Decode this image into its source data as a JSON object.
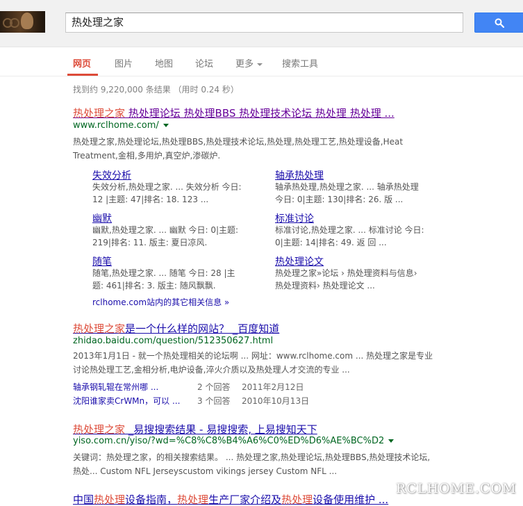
{
  "search": {
    "query": "热处理之家"
  },
  "tabs": [
    "网页",
    "图片",
    "地图",
    "论坛",
    "更多",
    "搜索工具"
  ],
  "stats": "找到约 9,220,000 条结果 （用时 0.24 秒）",
  "results": [
    {
      "title_hl": "热处理之家",
      "title_rest": " 热处理论坛 热处理BBS 热处理技术论坛 热处理 热处理 ...",
      "url": "www.rclhome.com/",
      "snippet": "热处理之家,热处理论坛,热处理BBS,热处理技术论坛,热处理,热处理工艺,热处理设备,Heat Treatment,金相,多用炉,真空炉,渗碳炉.",
      "sitelinks": [
        {
          "title": "失效分析",
          "snippet": "失效分析,热处理之家. ... 失效分析 今日: 12 |主题: 47|排名: 18. 123 ..."
        },
        {
          "title": "轴承热处理",
          "snippet": "轴承热处理,热处理之家. ... 轴承热处理 今日: 0|主题: 130|排名: 26. 版 ..."
        },
        {
          "title": "幽默",
          "snippet": "幽默,热处理之家. ... 幽默 今日: 0|主题: 219|排名: 11. 版主: 夏日凉风."
        },
        {
          "title": "标准讨论",
          "snippet": "标准讨论,热处理之家. ... 标准讨论 今日: 0|主题: 14|排名: 49. 返 回 ..."
        },
        {
          "title": "随笔",
          "snippet": "随笔,热处理之家. ... 随笔 今日: 28 |主题: 461|排名: 3. 版主: 随风飘飘."
        },
        {
          "title": "热处理论文",
          "snippet": "热处理之家»论坛 › 热处理资料与信息› 热处理资料› 热处理论文 ..."
        }
      ],
      "more_link": "rclhome.com站内的其它相关信息 »"
    },
    {
      "title_hl": "热处理之家",
      "title_rest": "是一个什么样的网站？ _百度知道",
      "url": "zhidao.baidu.com/question/512350627.html",
      "snippet": "2013年1月1日 - 就一个热处理相关的论坛啊 ... 网址：www.rclhome.com ... 热处理之家是专业讨论热处理工艺,金相分析,电炉设备,淬火介质以及热处理人才交流的专业 ...",
      "qa": [
        {
          "q": "轴承钢轧辊在常州哪 ...",
          "count": "2 个回答",
          "date": "2011年2月12日"
        },
        {
          "q": "沈阳谁家卖CrWMn，可以 ...",
          "count": "3 个回答",
          "date": "2010年10月13日"
        }
      ]
    },
    {
      "title_hl": "热处理之家",
      "title_rest": " _易搜搜索结果 - 易搜搜索, 上易搜知天下",
      "url": "yiso.com.cn/yiso/?wd=%C8%C8%B4%A6%C0%ED%D6%AE%BC%D2",
      "snippet": "关键词：热处理之家，的相关搜索结果。 ... 热处理之家,热处理论坛,热处理BBS,热处理技术论坛,热处... Custom NFL Jerseyscustom vikings jersey Custom NFL ..."
    },
    {
      "t1": "中国",
      "t2": "热处理",
      "t3": "设备指南，",
      "t4": "热处理",
      "t5": "生产厂家介绍及",
      "t6": "热处理",
      "t7": "设备使用维护 ..."
    }
  ],
  "watermark": "RCLHOME.COM"
}
